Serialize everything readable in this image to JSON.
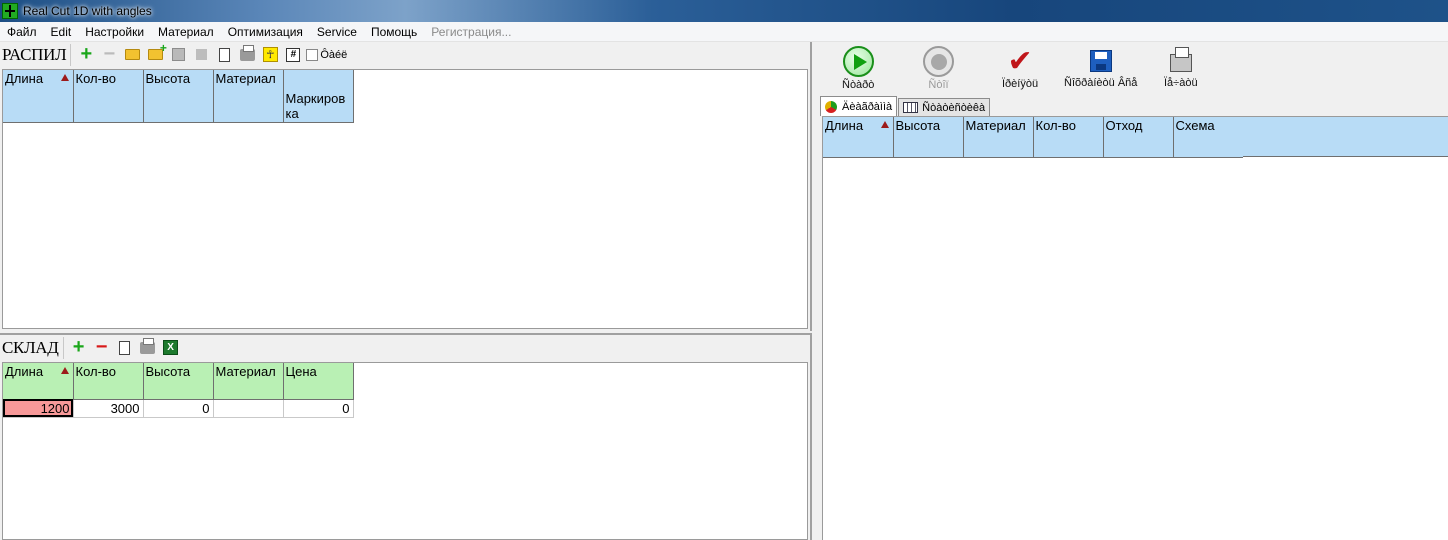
{
  "window": {
    "title": "Real Cut 1D with angles"
  },
  "menu": [
    {
      "label": "Файл",
      "disabled": false
    },
    {
      "label": "Edit",
      "disabled": false
    },
    {
      "label": "Настройки",
      "disabled": false
    },
    {
      "label": "Материал",
      "disabled": false
    },
    {
      "label": "Оптимизация",
      "disabled": false
    },
    {
      "label": "Service",
      "disabled": false
    },
    {
      "label": "Помощь",
      "disabled": false
    },
    {
      "label": "Регистрация...",
      "disabled": true
    }
  ],
  "raspil": {
    "label": "РАСПИЛ",
    "checkbox_label": "Ôàéë",
    "columns": [
      "Длина",
      "Кол-во",
      "Высота",
      "Материал",
      "Маркировка"
    ]
  },
  "sklad": {
    "label": "СКЛАД",
    "columns": [
      "Длина",
      "Кол-во",
      "Высота",
      "Материал",
      "Цена"
    ],
    "rows": [
      [
        "1200",
        "3000",
        "0",
        "",
        "0"
      ]
    ]
  },
  "right": {
    "buttons": {
      "start": "Ñòàðò",
      "stop": "Ñòîï",
      "check": "Ïðèíÿòü",
      "save": "Ñîõðàíèòü Âñå",
      "print": "Ïå÷àòü"
    },
    "tabs": [
      "Äèàãðàììà",
      "Ñòàòèñòèêà"
    ],
    "columns": [
      "Длина",
      "Высота",
      "Материал",
      "Кол-во",
      "Отход",
      "Схема"
    ]
  },
  "colors": {
    "raspil_header": "#b8dcf6",
    "sklad_header": "#b9f0b4",
    "selected_cell": "#f79999"
  }
}
